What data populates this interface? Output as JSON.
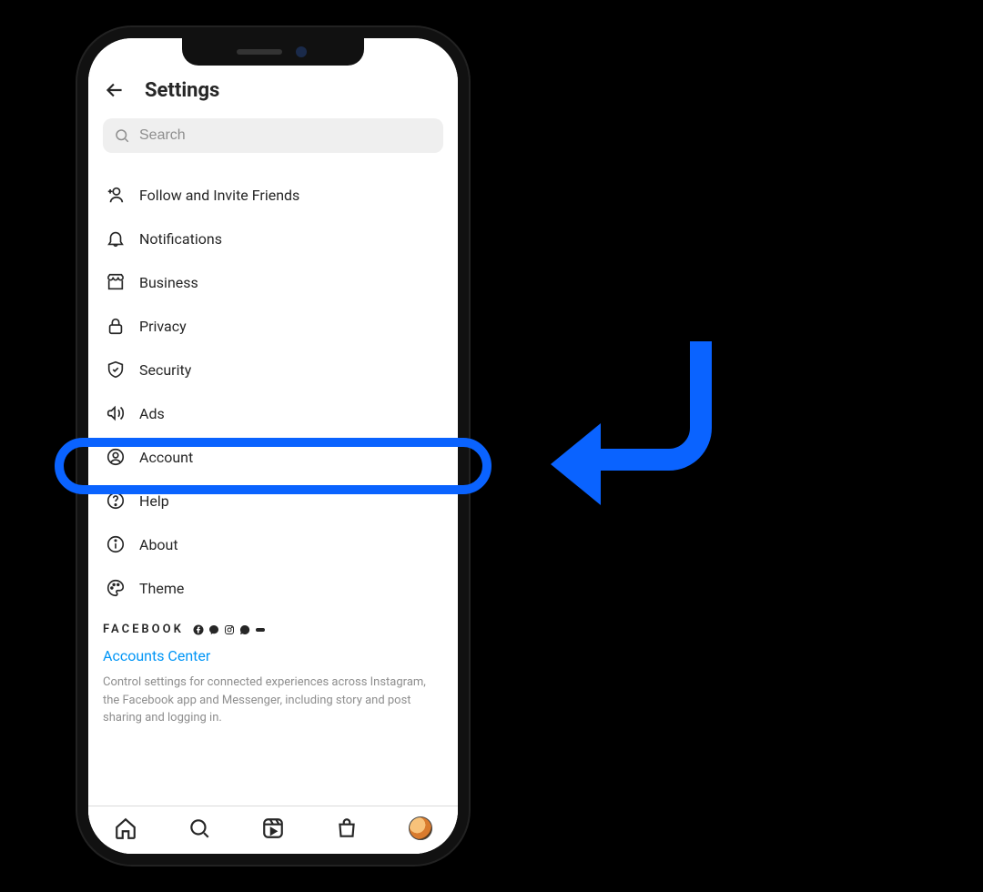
{
  "header": {
    "title": "Settings"
  },
  "search": {
    "placeholder": "Search"
  },
  "menu": [
    {
      "icon": "follow-invite-icon",
      "label": "Follow and Invite Friends"
    },
    {
      "icon": "bell-icon",
      "label": "Notifications"
    },
    {
      "icon": "storefront-icon",
      "label": "Business"
    },
    {
      "icon": "lock-icon",
      "label": "Privacy"
    },
    {
      "icon": "shield-check-icon",
      "label": "Security"
    },
    {
      "icon": "megaphone-icon",
      "label": "Ads"
    },
    {
      "icon": "account-circle-icon",
      "label": "Account"
    },
    {
      "icon": "help-circle-icon",
      "label": "Help"
    },
    {
      "icon": "info-circle-icon",
      "label": "About"
    },
    {
      "icon": "palette-icon",
      "label": "Theme"
    }
  ],
  "footer": {
    "brand": "FACEBOOK",
    "accounts_center_label": "Accounts Center",
    "accounts_center_desc": "Control settings for connected experiences across Instagram, the Facebook app and Messenger, including story and post sharing and logging in."
  },
  "tabs": [
    "home",
    "search",
    "reels",
    "shop",
    "profile"
  ],
  "annotation": {
    "highlight_target": "Account",
    "color": "#0a63ff"
  }
}
